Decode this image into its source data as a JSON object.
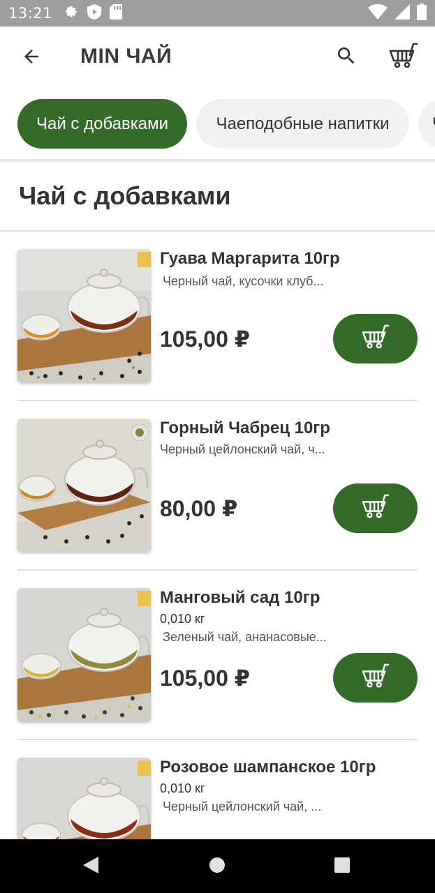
{
  "status_bar": {
    "time": "13:21",
    "icons": [
      "gear-icon",
      "shield-play-icon",
      "sd-card-icon"
    ],
    "right_icons": [
      "wifi-icon",
      "signal-icon",
      "battery-icon"
    ]
  },
  "app_bar": {
    "title": "MIN ЧАЙ",
    "back_icon": "arrow-left-icon",
    "search_icon": "search-icon",
    "cart_icon": "cart-icon"
  },
  "categories": [
    {
      "label": "Чай с добавками",
      "active": true
    },
    {
      "label": "Чаеподобные напитки",
      "active": false
    },
    {
      "label": "Ч",
      "active": false
    }
  ],
  "section": {
    "title": "Чай с добавками"
  },
  "products": [
    {
      "name": "Гуава Маргарита 10гр",
      "weight": "",
      "description": "Черный чай, кусочки клуб...",
      "price": "105,00 ₽"
    },
    {
      "name": "Горный Чабрец 10гр",
      "weight": "",
      "description": "Черный цейлонский чай, ч...",
      "price": "80,00 ₽"
    },
    {
      "name": "Манговый сад 10гр",
      "weight": "0,010 кг",
      "description": "Зеленый чай, ананасовые...",
      "price": "105,00 ₽"
    },
    {
      "name": "Розовое шампанское 10гр",
      "weight": "0,010 кг",
      "description": "Черный цейлонский чай, ...",
      "price": ""
    }
  ],
  "colors": {
    "accent": "#356b2a",
    "status_bar": "#9e9e9e",
    "chip_inactive": "#f1f1f1",
    "nav_bar": "#000000"
  }
}
